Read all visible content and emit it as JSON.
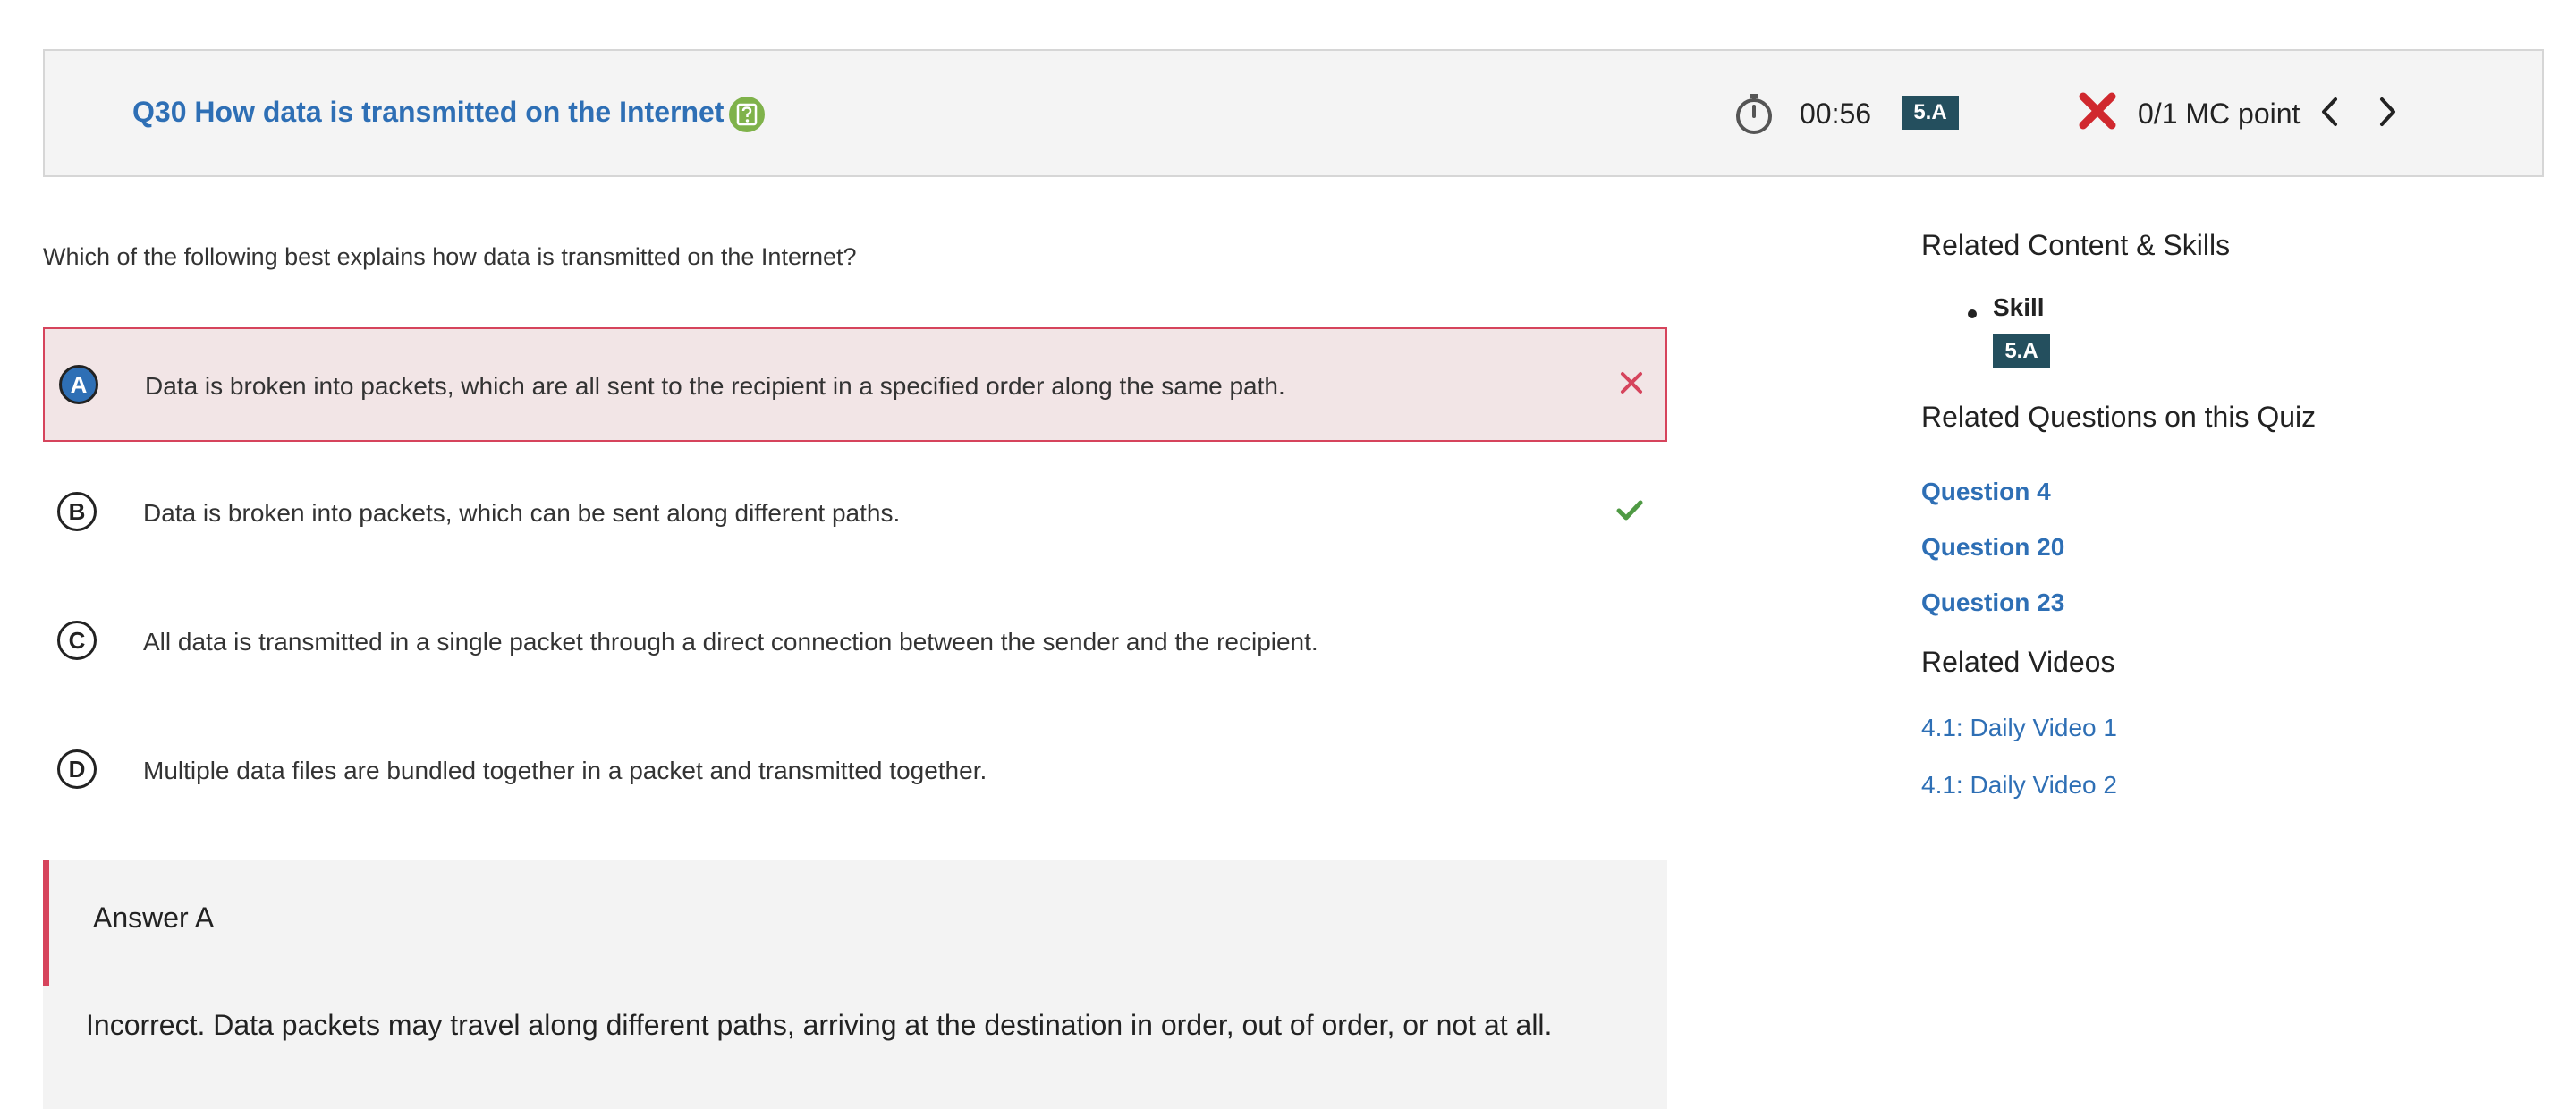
{
  "header": {
    "question_title": "Q30 How data is transmitted on the Internet",
    "timer": "00:56",
    "skill_badge": "5.A",
    "score": "0/1 MC point"
  },
  "question": {
    "prompt": "Which of the following best explains how data is transmitted on the Internet?",
    "choices": [
      {
        "letter": "A",
        "text": "Data is broken into packets, which are all sent to the recipient in a specified order along the same path.",
        "state": "selected-incorrect"
      },
      {
        "letter": "B",
        "text": "Data is broken into packets, which can be sent along different paths.",
        "state": "correct"
      },
      {
        "letter": "C",
        "text": "All data is transmitted in a single packet through a direct connection between the sender and the recipient.",
        "state": "none"
      },
      {
        "letter": "D",
        "text": "Multiple data files are bundled together in a packet and transmitted together.",
        "state": "none"
      }
    ]
  },
  "answer": {
    "title": "Answer A",
    "explanation": "Incorrect. Data packets may travel along different paths, arriving at the destination in order, out of order, or not at all."
  },
  "sidebar": {
    "related_content_heading": "Related Content & Skills",
    "skill_label": "Skill",
    "skill_badge": "5.A",
    "related_questions_heading": "Related Questions on this Quiz",
    "related_questions": [
      "Question 4",
      "Question 20",
      "Question 23"
    ],
    "related_videos_heading": "Related Videos",
    "related_videos": [
      "4.1: Daily Video 1",
      "4.1: Daily Video 2"
    ]
  },
  "colors": {
    "link_blue": "#2e6fb5",
    "incorrect_red": "#d6445c",
    "correct_green": "#4f9a44",
    "badge_teal": "#244f5e",
    "help_icon_green": "#7fb24a"
  },
  "icons": {
    "help": "question-mark-square-icon",
    "timer": "stopwatch-icon",
    "score_status": "red-x-icon",
    "prev": "chevron-left-icon",
    "next": "chevron-right-icon",
    "incorrect_mark": "x-mark-icon",
    "correct_mark": "checkmark-icon"
  }
}
